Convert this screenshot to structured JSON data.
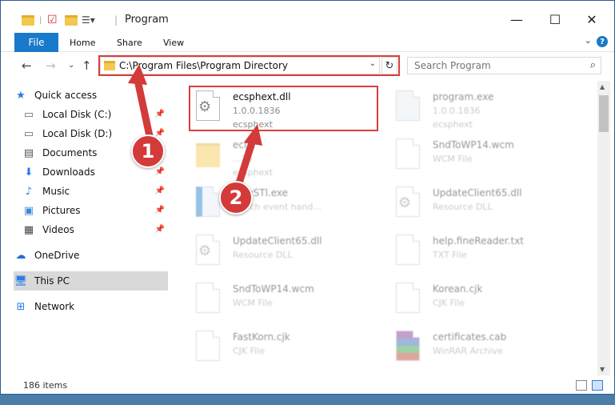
{
  "window": {
    "title": "Program"
  },
  "ribbon": {
    "file": "File",
    "tabs": [
      "Home",
      "Share",
      "View"
    ],
    "help": "?"
  },
  "address": {
    "path": "C:\\Program Files\\Program Directory"
  },
  "search": {
    "placeholder": "Search Program"
  },
  "sidebar": {
    "items": [
      {
        "label": "Quick access",
        "icon": "star-icon"
      },
      {
        "label": "Local Disk (C:)",
        "icon": "drive-icon",
        "pinned": true
      },
      {
        "label": "Local Disk (D:)",
        "icon": "drive-icon",
        "pinned": true
      },
      {
        "label": "Documents",
        "icon": "documents-icon",
        "pinned": true
      },
      {
        "label": "Downloads",
        "icon": "downloads-icon",
        "pinned": true
      },
      {
        "label": "Music",
        "icon": "music-icon",
        "pinned": true
      },
      {
        "label": "Pictures",
        "icon": "pictures-icon",
        "pinned": true
      },
      {
        "label": "Videos",
        "icon": "videos-icon",
        "pinned": true
      },
      {
        "label": "OneDrive",
        "icon": "cloud-icon"
      },
      {
        "label": "This PC",
        "icon": "computer-icon",
        "selected": true
      },
      {
        "label": "Network",
        "icon": "network-icon"
      }
    ]
  },
  "files": [
    {
      "name": "ecsphext.dll",
      "line2": "1.0.0.1836",
      "line3": "ecsphext",
      "highlight": true
    },
    {
      "name": "program.exe",
      "line2": "1.0.0.1836",
      "line3": "ecsphext"
    },
    {
      "name": "ecf...",
      "line2": "...36",
      "line3": "ecsphext"
    },
    {
      "name": "SndToWP14.wcm",
      "line2": "WCM File",
      "line3": ""
    },
    {
      "name": "...yySTl.exe",
      "line2": "...t' ch event hand...",
      "line3": ""
    },
    {
      "name": "UpdateClient65.dll",
      "line2": "Resource DLL",
      "line3": ""
    },
    {
      "name": "UpdateClient65.dll",
      "line2": "Resource DLL",
      "line3": ""
    },
    {
      "name": "help.fineReader.txt",
      "line2": "TXT File",
      "line3": ""
    },
    {
      "name": "SndToWP14.wcm",
      "line2": "WCM File",
      "line3": ""
    },
    {
      "name": "Korean.cjk",
      "line2": "CJK File",
      "line3": ""
    },
    {
      "name": "FastKorn.cjk",
      "line2": "CJK File",
      "line3": ""
    },
    {
      "name": "certificates.cab",
      "line2": "WinRAR Archive",
      "line3": ""
    }
  ],
  "status": {
    "count": "186 items"
  },
  "callouts": {
    "one": "1",
    "two": "2"
  },
  "colors": {
    "accent": "#1979ca",
    "highlight": "#d93f3f",
    "selected": "#d9d9d9"
  }
}
